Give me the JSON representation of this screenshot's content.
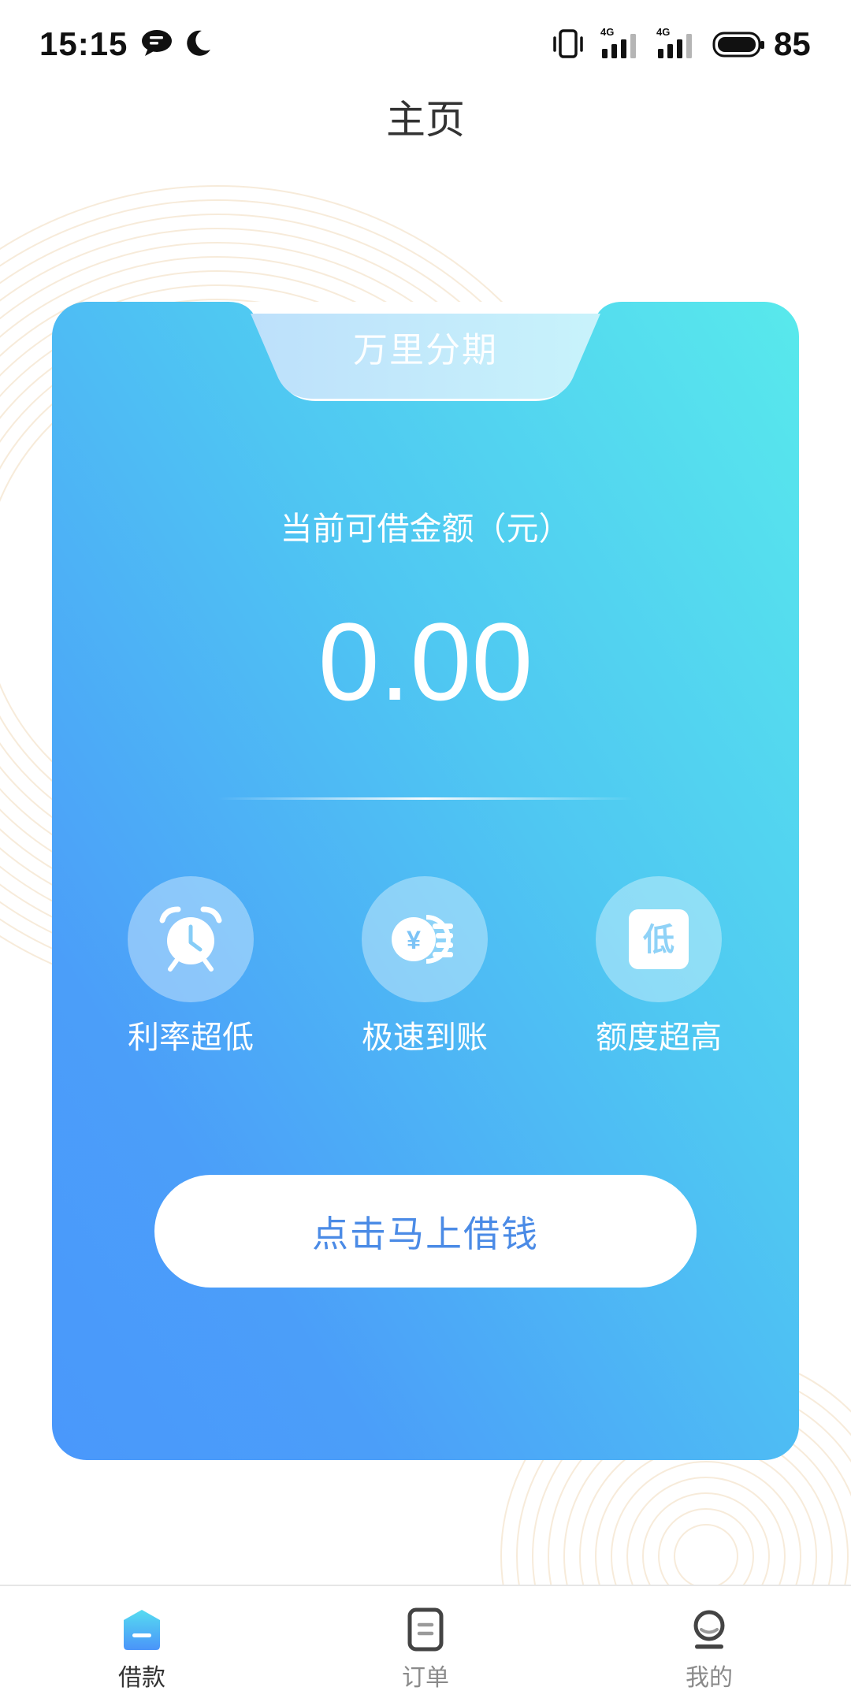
{
  "status_bar": {
    "time": "15:15",
    "network_1": "4G",
    "network_2": "4G",
    "battery": "85",
    "icons": [
      "message-icon",
      "moon-icon",
      "vibrate-icon",
      "signal-icon",
      "signal-icon",
      "battery-icon"
    ]
  },
  "header": {
    "title": "主页"
  },
  "loan_card": {
    "tab_label": "万里分期",
    "amount_label": "当前可借金额（元）",
    "amount": "0.00",
    "features": [
      {
        "label": "利率超低",
        "icon": "alarm-clock-icon"
      },
      {
        "label": "极速到账",
        "icon": "yen-coin-icon",
        "icon_text": "¥"
      },
      {
        "label": "额度超高",
        "icon": "low-badge-icon",
        "icon_text": "低"
      }
    ],
    "cta_label": "点击马上借钱"
  },
  "bottom_nav": {
    "items": [
      {
        "label": "借款",
        "icon": "home-icon",
        "active": true
      },
      {
        "label": "订单",
        "icon": "order-list-icon",
        "active": false
      },
      {
        "label": "我的",
        "icon": "profile-icon",
        "active": false
      }
    ]
  },
  "theme": {
    "card_gradient_start": "#58e9ec",
    "card_gradient_end": "#4a98fb",
    "cta_text": "#4b8be6",
    "nav_active": "#333333",
    "nav_inactive": "#8a8a8a",
    "decor_ring": "#f6e8d4"
  }
}
